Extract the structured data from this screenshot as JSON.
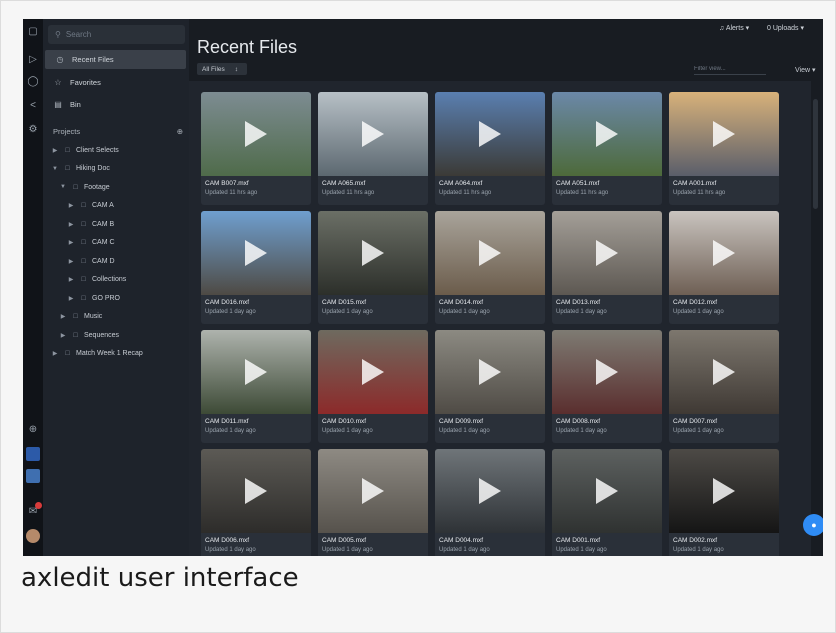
{
  "sidebar": {
    "search_placeholder": "Search",
    "nav": [
      {
        "label": "Recent Files",
        "icon": "clock-icon",
        "active": true
      },
      {
        "label": "Favorites",
        "icon": "star-icon",
        "active": false
      },
      {
        "label": "Bin",
        "icon": "bin-icon",
        "active": false
      }
    ],
    "projects_label": "Projects",
    "tree": [
      {
        "label": "Client Selects",
        "depth": 0,
        "expanded": false
      },
      {
        "label": "Hiking Doc",
        "depth": 0,
        "expanded": true
      },
      {
        "label": "Footage",
        "depth": 1,
        "expanded": true
      },
      {
        "label": "CAM A",
        "depth": 2,
        "expanded": false
      },
      {
        "label": "CAM B",
        "depth": 2,
        "expanded": false
      },
      {
        "label": "CAM C",
        "depth": 2,
        "expanded": false
      },
      {
        "label": "CAM D",
        "depth": 2,
        "expanded": false
      },
      {
        "label": "Collections",
        "depth": 2,
        "expanded": false
      },
      {
        "label": "GO PRO",
        "depth": 2,
        "expanded": false
      },
      {
        "label": "Music",
        "depth": 1,
        "expanded": false
      },
      {
        "label": "Sequences",
        "depth": 1,
        "expanded": false
      },
      {
        "label": "Match Week 1 Recap",
        "depth": 0,
        "expanded": false
      }
    ]
  },
  "header": {
    "alerts_label": "Alerts",
    "uploads_label": "Uploads",
    "uploads_count": "0"
  },
  "main": {
    "title": "Recent Files",
    "filter_select": "All Files",
    "filter_placeholder": "Filter view...",
    "view_label": "View"
  },
  "files": [
    {
      "name": "CAM B007.mxf",
      "updated": "Updated 11 hrs ago",
      "colors": [
        "#7d8c92",
        "#4f6b4a"
      ]
    },
    {
      "name": "CAM A065.mxf",
      "updated": "Updated 11 hrs ago",
      "colors": [
        "#b7c0c6",
        "#5c6870"
      ]
    },
    {
      "name": "CAM A064.mxf",
      "updated": "Updated 11 hrs ago",
      "colors": [
        "#5a7fb0",
        "#3b3a36"
      ]
    },
    {
      "name": "CAM A051.mxf",
      "updated": "Updated 11 hrs ago",
      "colors": [
        "#6b88a8",
        "#4d6a3a"
      ]
    },
    {
      "name": "CAM A001.mxf",
      "updated": "Updated 11 hrs ago",
      "colors": [
        "#d8b27a",
        "#5a5e6a"
      ]
    },
    {
      "name": "CAM D016.mxf",
      "updated": "Updated 1 day ago",
      "colors": [
        "#6f9fcf",
        "#4e4a44"
      ]
    },
    {
      "name": "CAM D015.mxf",
      "updated": "Updated 1 day ago",
      "colors": [
        "#6b6f66",
        "#2c2f2a"
      ]
    },
    {
      "name": "CAM D014.mxf",
      "updated": "Updated 1 day ago",
      "colors": [
        "#a9a49b",
        "#6b5c4b"
      ]
    },
    {
      "name": "CAM D013.mxf",
      "updated": "Updated 1 day ago",
      "colors": [
        "#a49f98",
        "#5d5852"
      ]
    },
    {
      "name": "CAM D012.mxf",
      "updated": "Updated 1 day ago",
      "colors": [
        "#c9c4bf",
        "#6e5f54"
      ]
    },
    {
      "name": "CAM D011.mxf",
      "updated": "Updated 1 day ago",
      "colors": [
        "#aeb3ad",
        "#3d4a36"
      ]
    },
    {
      "name": "CAM D010.mxf",
      "updated": "Updated 1 day ago",
      "colors": [
        "#6e6a5f",
        "#8c2a2a"
      ]
    },
    {
      "name": "CAM D009.mxf",
      "updated": "Updated 1 day ago",
      "colors": [
        "#8c8a82",
        "#4f4b45"
      ]
    },
    {
      "name": "CAM D008.mxf",
      "updated": "Updated 1 day ago",
      "colors": [
        "#7e7b73",
        "#5a2e2e"
      ]
    },
    {
      "name": "CAM D007.mxf",
      "updated": "Updated 1 day ago",
      "colors": [
        "#7d776e",
        "#3f3934"
      ]
    },
    {
      "name": "CAM D006.mxf",
      "updated": "Updated 1 day ago",
      "colors": [
        "#5c5a55",
        "#2d2c2a"
      ]
    },
    {
      "name": "CAM D005.mxf",
      "updated": "Updated 1 day ago",
      "colors": [
        "#8e8a83",
        "#56524c"
      ]
    },
    {
      "name": "CAM D004.mxf",
      "updated": "Updated 1 day ago",
      "colors": [
        "#6f7579",
        "#2e3236"
      ]
    },
    {
      "name": "CAM D001.mxf",
      "updated": "Updated 1 day ago",
      "colors": [
        "#5d6160",
        "#2f3231"
      ]
    },
    {
      "name": "CAM D002.mxf",
      "updated": "Updated 1 day ago",
      "colors": [
        "#4d4a46",
        "#151515"
      ]
    }
  ],
  "caption": "axledit user interface",
  "colors": {
    "accent": "#2f8cf5",
    "active_nav": "#3a4049"
  }
}
